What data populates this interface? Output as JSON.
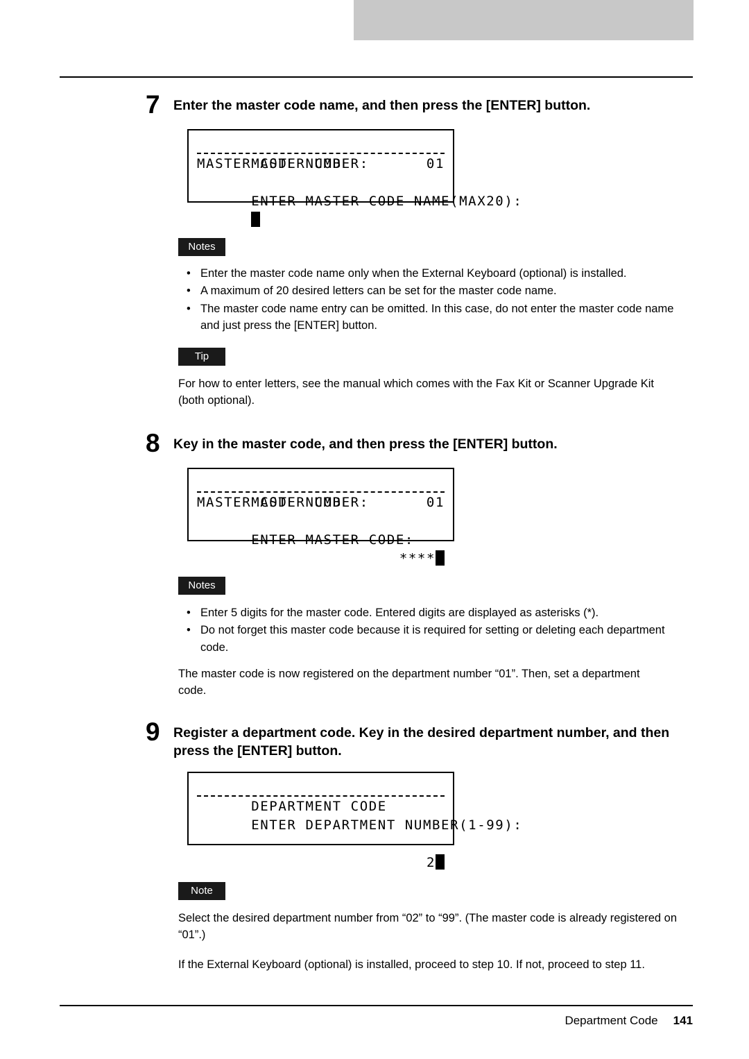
{
  "footer": {
    "label": "Department Code",
    "page_number": "141"
  },
  "step7": {
    "number": "7",
    "heading": "Enter the master code name, and then press the [ENTER] button.",
    "lcd": {
      "line1": "MASTER CODE",
      "line2_left": "MASTER CODE NUMBER:",
      "line2_right": "01",
      "line3": "ENTER MASTER CODE NAME(MAX20):",
      "line4": ""
    },
    "notes_badge": "Notes",
    "notes": [
      "Enter the master code name only when the External Keyboard (optional) is installed.",
      "A maximum of 20 desired letters can be set for the master code name.",
      "The master code name entry can be omitted. In this case, do not enter the master code name and just press the [ENTER] button."
    ],
    "tip_badge": "Tip",
    "tip_text": "For how to enter letters, see the manual which comes with the Fax Kit or Scanner Upgrade Kit (both optional)."
  },
  "step8": {
    "number": "8",
    "heading": "Key in the master code, and then press the [ENTER] button.",
    "lcd": {
      "line1": "MASTER CODE",
      "line2_left": "MASTER CODE NUMBER:",
      "line2_right": "01",
      "line3": "ENTER MASTER CODE:",
      "line4_right": "****"
    },
    "notes_badge": "Notes",
    "notes": [
      "Enter 5 digits for the master code. Entered digits are displayed as asterisks (*).",
      "Do not forget this master code because it is required for setting or deleting each department code."
    ],
    "paragraph": "The master code is now registered on the department number “01”. Then, set a department code."
  },
  "step9": {
    "number": "9",
    "heading": "Register a department code. Key in the desired department number, and then press the [ENTER] button.",
    "lcd": {
      "line1": "DEPARTMENT CODE",
      "line2": "ENTER DEPARTMENT NUMBER(1-99):",
      "line3": "",
      "line4_right": "2"
    },
    "note_badge": "Note",
    "note_text": "Select the desired department number from “02” to “99”. (The master code is already registered on “01”.)",
    "paragraph": "If the External Keyboard (optional) is installed, proceed to step 10. If not, proceed to step 11."
  }
}
